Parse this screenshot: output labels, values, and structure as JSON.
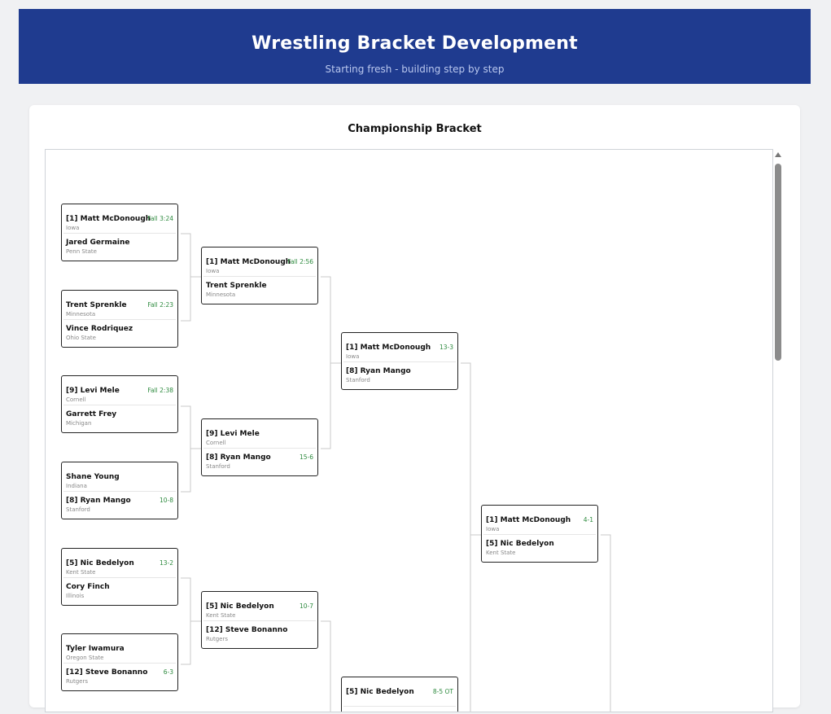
{
  "header": {
    "title": "Wrestling Bracket Development",
    "subtitle": "Starting fresh - building step by step"
  },
  "bracket": {
    "title": "Championship Bracket",
    "matches": [
      {
        "top": {
          "name": "[1] Matt McDonough",
          "school": "Iowa",
          "result": "Fall 3:24"
        },
        "bottom": {
          "name": "Jared Germaine",
          "school": "Penn State",
          "result": ""
        }
      },
      {
        "top": {
          "name": "Trent Sprenkle",
          "school": "Minnesota",
          "result": "Fall 2:23"
        },
        "bottom": {
          "name": "Vince Rodriquez",
          "school": "Ohio State",
          "result": ""
        }
      },
      {
        "top": {
          "name": "[9] Levi Mele",
          "school": "Cornell",
          "result": "Fall 2:38"
        },
        "bottom": {
          "name": "Garrett Frey",
          "school": "Michigan",
          "result": ""
        }
      },
      {
        "top": {
          "name": "Shane Young",
          "school": "Indiana",
          "result": ""
        },
        "bottom": {
          "name": "[8] Ryan Mango",
          "school": "Stanford",
          "result": "10-8"
        }
      },
      {
        "top": {
          "name": "[5] Nic Bedelyon",
          "school": "Kent State",
          "result": "13-2"
        },
        "bottom": {
          "name": "Cory Finch",
          "school": "Illinois",
          "result": ""
        }
      },
      {
        "top": {
          "name": "Tyler Iwamura",
          "school": "Oregon State",
          "result": ""
        },
        "bottom": {
          "name": "[12] Steve Bonanno",
          "school": "Rutgers",
          "result": "6-3"
        }
      },
      {
        "top": {
          "name": "[1] Matt McDonough",
          "school": "Iowa",
          "result": "Fall 2:56"
        },
        "bottom": {
          "name": "Trent Sprenkle",
          "school": "Minnesota",
          "result": ""
        }
      },
      {
        "top": {
          "name": "[9] Levi Mele",
          "school": "Cornell",
          "result": ""
        },
        "bottom": {
          "name": "[8] Ryan Mango",
          "school": "Stanford",
          "result": "15-6"
        }
      },
      {
        "top": {
          "name": "[5] Nic Bedelyon",
          "school": "Kent State",
          "result": "10-7"
        },
        "bottom": {
          "name": "[12] Steve Bonanno",
          "school": "Rutgers",
          "result": ""
        }
      },
      {
        "top": {
          "name": "[1] Matt McDonough",
          "school": "Iowa",
          "result": "13-3"
        },
        "bottom": {
          "name": "[8] Ryan Mango",
          "school": "Stanford",
          "result": ""
        }
      },
      {
        "top": {
          "name": "[5] Nic Bedelyon",
          "school": "",
          "result": "8-5 OT"
        },
        "bottom": {
          "name": "",
          "school": "",
          "result": ""
        }
      },
      {
        "top": {
          "name": "[1] Matt McDonough",
          "school": "Iowa",
          "result": "4-1"
        },
        "bottom": {
          "name": "[5] Nic Bedelyon",
          "school": "Kent State",
          "result": ""
        }
      }
    ]
  }
}
